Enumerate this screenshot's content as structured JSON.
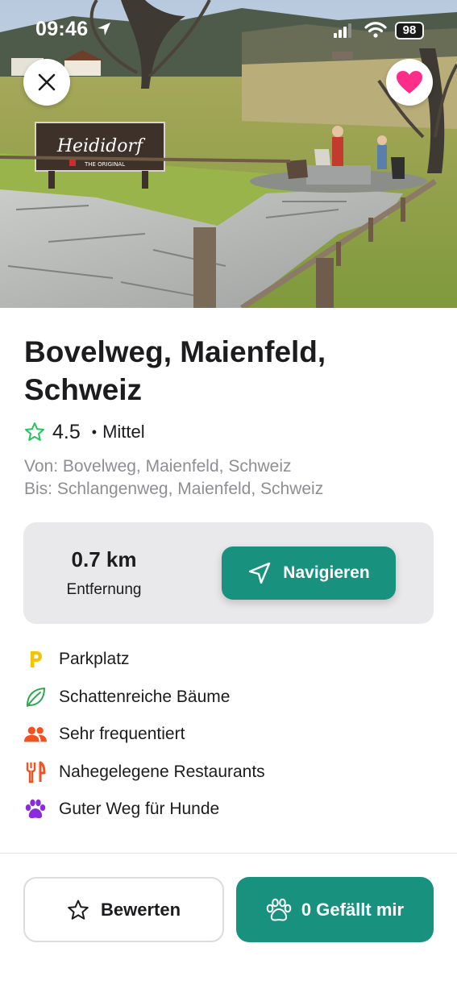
{
  "status_bar": {
    "time": "09:46",
    "battery": "98"
  },
  "hero": {
    "photo": "Heididorf village path with wooden fence and goat statues",
    "sign_text": "Heididorf",
    "sign_subtext": "THE ORIGINAL"
  },
  "place": {
    "title": "Bovelweg, Maienfeld, Schweiz",
    "rating": "4.5",
    "separator": "•",
    "difficulty": "Mittel",
    "from": "Von: Bovelweg, Maienfeld, Schweiz",
    "to": "Bis: Schlangenweg, Maienfeld, Schweiz"
  },
  "distance_card": {
    "value": "0.7 km",
    "label": "Entfernung",
    "navigate_label": "Navigieren"
  },
  "features": [
    {
      "icon": "parking-icon",
      "label": "Parkplatz",
      "color": "#f5c400"
    },
    {
      "icon": "leaf-icon",
      "label": "Schattenreiche Bäume",
      "color": "#2fa84f"
    },
    {
      "icon": "people-icon",
      "label": "Sehr frequentiert",
      "color": "#f4511e"
    },
    {
      "icon": "fork-knife-icon",
      "label": "Nahegelegene Restaurants",
      "color": "#f4511e"
    },
    {
      "icon": "paw-icon",
      "label": "Guter Weg für Hunde",
      "color": "#8a2be2"
    }
  ],
  "actions": {
    "rate_label": "Bewerten",
    "like_label": "0 Gefällt mir"
  },
  "colors": {
    "accent": "#18917f",
    "favorite": "#ff2d8a",
    "star_outline": "#22c55e"
  }
}
